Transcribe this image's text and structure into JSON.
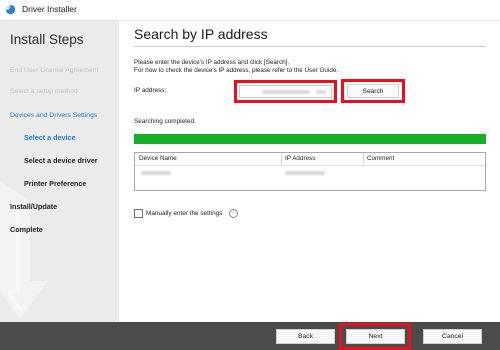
{
  "window": {
    "title": "Driver Installer",
    "icon": "driver-installer-icon"
  },
  "sidebar": {
    "title": "Install Steps",
    "items": [
      {
        "label": "End User License Agreement",
        "state": "done"
      },
      {
        "label": "Select a setup method",
        "state": "done"
      },
      {
        "label": "Devices and Drivers Settings",
        "state": "active"
      },
      {
        "label": "Select a device",
        "state": "current"
      },
      {
        "label": "Select a device driver",
        "state": "pending"
      },
      {
        "label": "Printer Preference",
        "state": "pending"
      },
      {
        "label": "Install/Update",
        "state": "pending"
      },
      {
        "label": "Complete",
        "state": "pending"
      }
    ]
  },
  "main": {
    "title": "Search by IP address",
    "instruction_line1": "Please enter the device's IP address and click [Search].",
    "instruction_line2": "For how to check the device's IP address, please refer to the User Guide.",
    "ip_label": "IP address:",
    "ip_value": "",
    "search_button": "Search",
    "status": "Searching completed.",
    "progress": 1.0,
    "table": {
      "columns": [
        "Device Name",
        "IP Address",
        "Comment"
      ]
    },
    "manual_checkbox_label": "Manually enter the settings",
    "manual_checked": false
  },
  "footer": {
    "back": "Back",
    "next": "Next",
    "cancel": "Cancel"
  },
  "colors": {
    "highlight": "#e8101c",
    "progress": "#15b028",
    "active_step": "#1f78c8",
    "footer_bg": "#4b4b4b"
  }
}
